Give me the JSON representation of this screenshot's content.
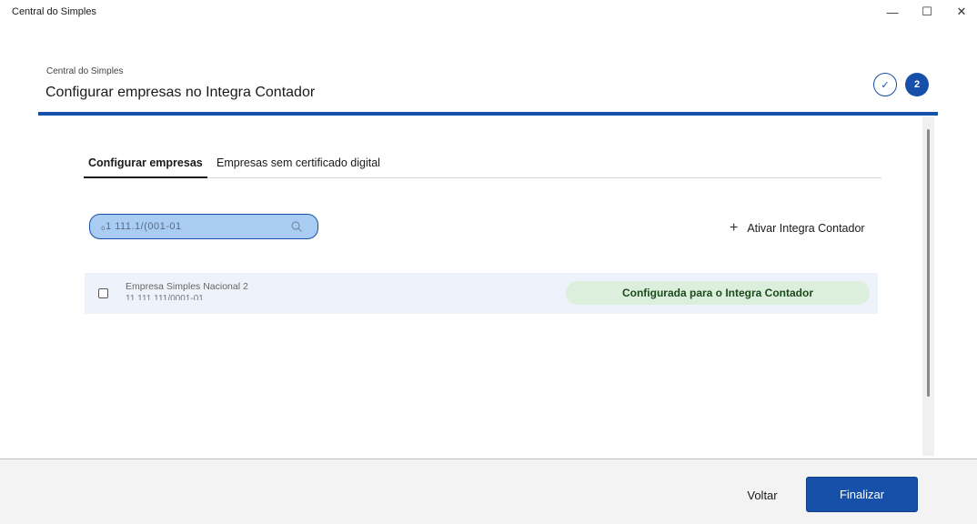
{
  "window": {
    "title": "Central do Simples",
    "minimize_glyph": "—",
    "maximize_glyph": "☐",
    "close_glyph": "✕"
  },
  "header": {
    "breadcrumb": "Central do Simples",
    "title": "Configurar empresas no Integra Contador",
    "steps": [
      {
        "label": "✓",
        "state": "done"
      },
      {
        "label": "2",
        "state": "current"
      }
    ]
  },
  "tabs": [
    {
      "label": "Configurar empresas",
      "active": true
    },
    {
      "label": "Empresas sem certificado digital",
      "active": false
    }
  ],
  "search": {
    "value": "₀1 111.1/(001-01",
    "icon": "search-icon"
  },
  "activate_button": {
    "icon": "plus-icon",
    "label": "Ativar Integra Contador"
  },
  "companies": [
    {
      "name": "Empresa Simples Nacional 2",
      "document": "11.111.111/0001-01",
      "status": "Configurada para o Integra Contador",
      "checked": false
    }
  ],
  "footer": {
    "back_label": "Voltar",
    "finish_label": "Finalizar"
  },
  "colors": {
    "accent": "#1650a8",
    "row_background": "#eef3fb",
    "status_badge": "#dcefdc",
    "search_background": "#a9cdf2"
  }
}
